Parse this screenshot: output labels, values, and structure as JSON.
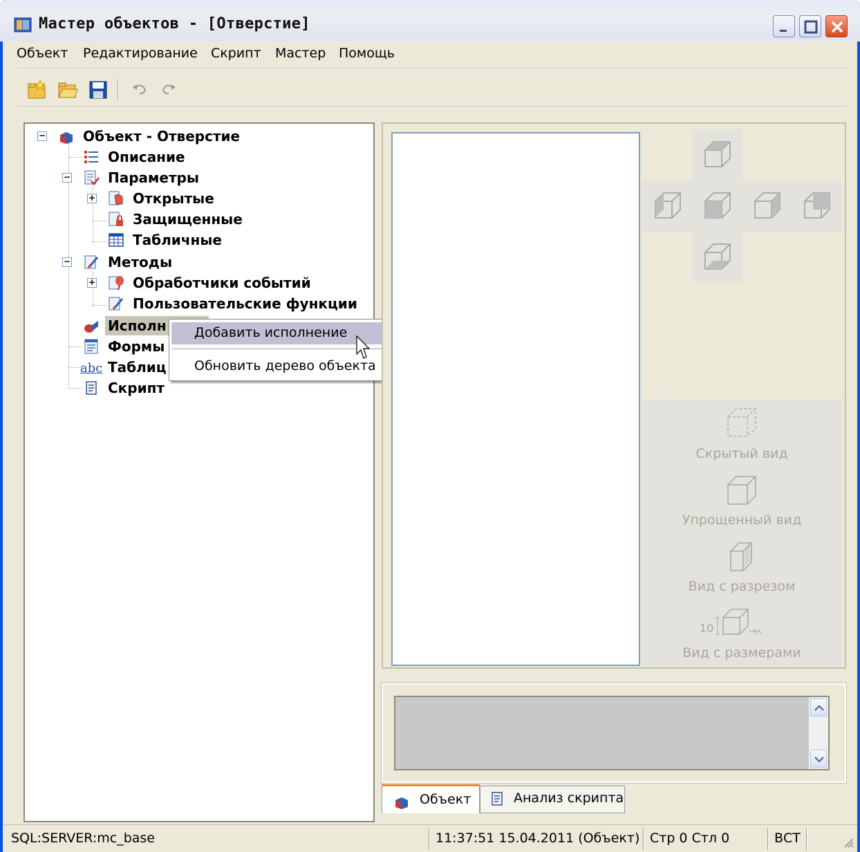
{
  "window": {
    "title": "Мастер объектов - [Отверстие]"
  },
  "menu": {
    "items": [
      "Объект",
      "Редактирование",
      "Скрипт",
      "Мастер",
      "Помощь"
    ]
  },
  "toolbar": {
    "buttons": [
      "new-icon",
      "open-folder-icon",
      "save-icon",
      "undo-icon",
      "redo-icon"
    ]
  },
  "tree": {
    "root": "Объект - Отверстие",
    "items": [
      {
        "label": "Описание",
        "icon": "list-icon"
      },
      {
        "label": "Параметры",
        "icon": "params-icon"
      },
      {
        "label": "Открытые",
        "icon": "open-params-icon"
      },
      {
        "label": "Защищенные",
        "icon": "lock-params-icon"
      },
      {
        "label": "Табличные",
        "icon": "table-icon"
      },
      {
        "label": "Методы",
        "icon": "methods-icon"
      },
      {
        "label": "Обработчики событий",
        "icon": "event-handlers-icon"
      },
      {
        "label": "Пользовательские функции",
        "icon": "user-functions-icon"
      },
      {
        "label": "Исполн",
        "icon": "execution-icon"
      },
      {
        "label": "Формы",
        "icon": "forms-icon"
      },
      {
        "label": "Таблиц",
        "icon": "abc-icon"
      },
      {
        "label": "Скрипт",
        "icon": "script-icon"
      }
    ]
  },
  "context_menu": {
    "items": [
      "Добавить исполнение",
      "Обновить дерево объекта"
    ]
  },
  "views": {
    "hidden": "Скрытый вид",
    "simplified": "Упрощенный вид",
    "section": "Вид с разрезом",
    "dimensions": "Вид с размерами",
    "dimension_value": "10"
  },
  "tabs": {
    "object": "Объект",
    "script_analysis": "Анализ скрипта"
  },
  "status": {
    "connection": "SQL:SERVER:mc_base",
    "datetime": "11:37:51  15.04.2011  (Объект)",
    "position": "Стр 0 Стл 0",
    "mode": "ВСТ"
  },
  "colors": {
    "titlebar_close": "#d8461d",
    "tab_accent": "#e68b2c",
    "menu_highlight": "#c1bfd3"
  }
}
